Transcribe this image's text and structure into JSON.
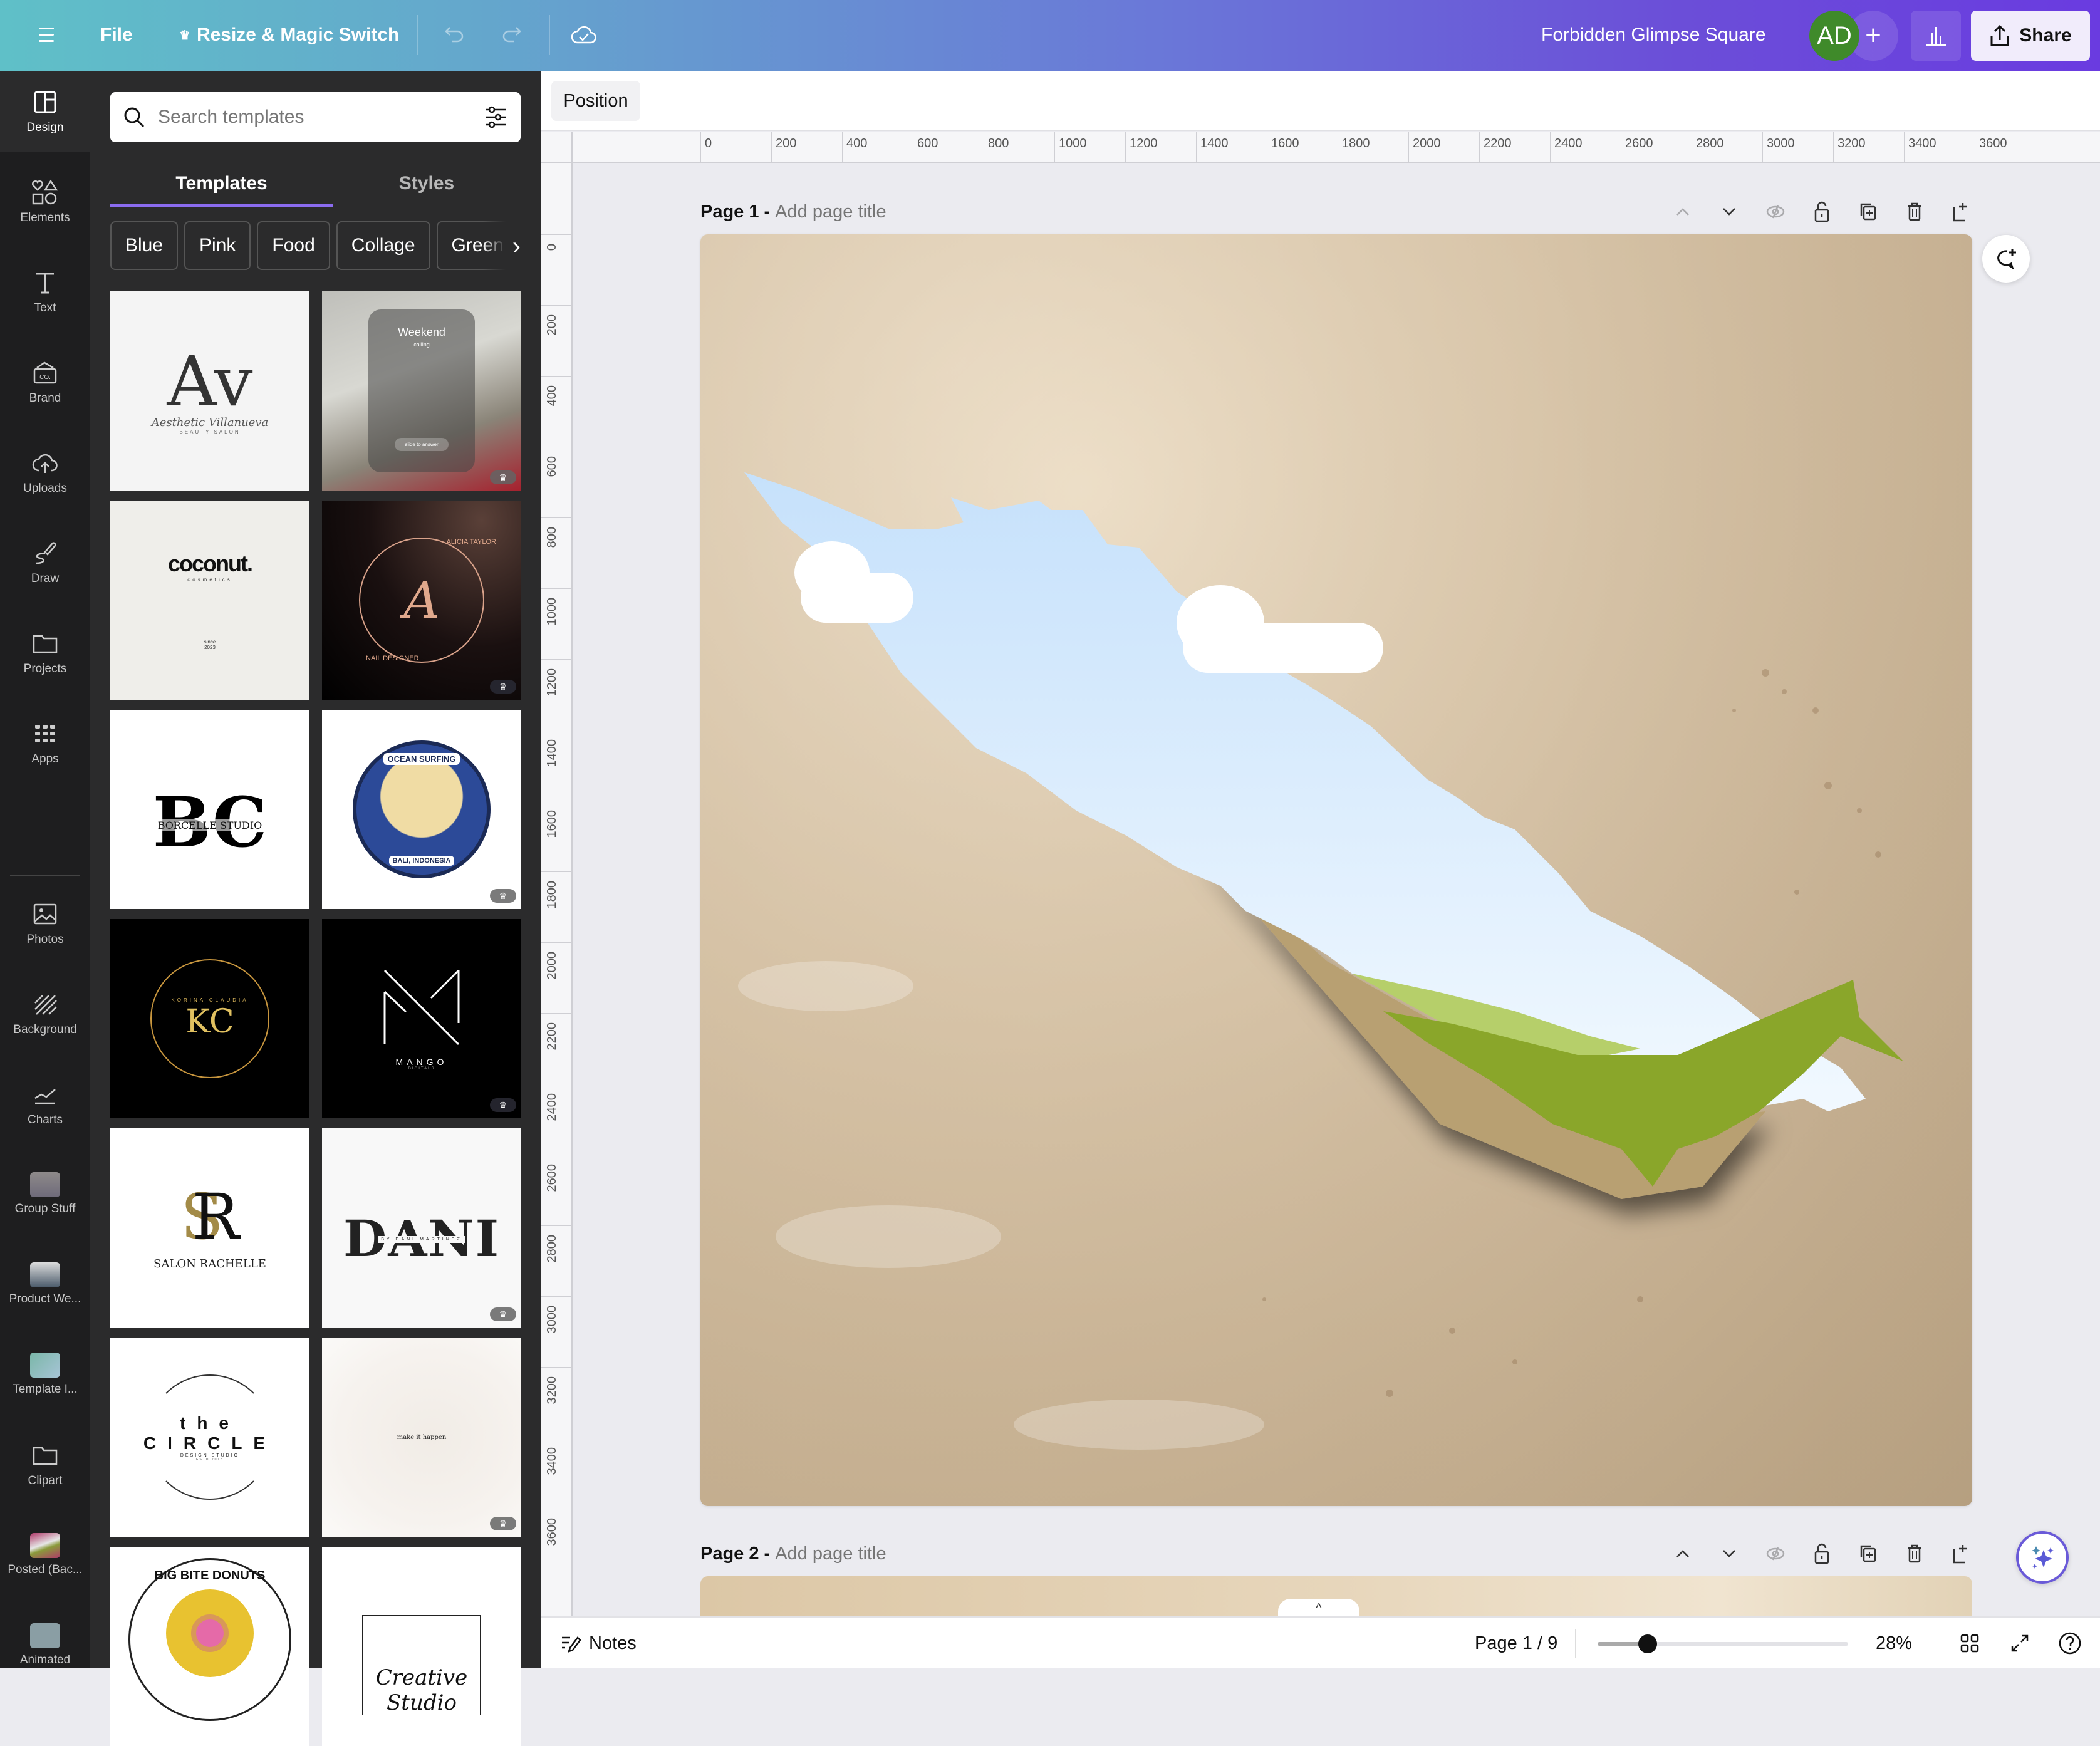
{
  "topbar": {
    "menu_icon": "hamburger-menu-icon",
    "file_label": "File",
    "resize_label": "Resize & Magic Switch",
    "undo_icon": "undo-icon",
    "redo_icon": "redo-icon",
    "save_status_icon": "cloud-check-icon",
    "design_title": "Forbidden Glimpse Square",
    "avatar_initials": "AD",
    "add_collaborator": "+",
    "analytics_icon": "bar-chart-icon",
    "share_label": "Share"
  },
  "rail": {
    "items": [
      {
        "label": "Design",
        "icon": "design-layout-icon",
        "active": true
      },
      {
        "label": "Elements",
        "icon": "shapes-icon"
      },
      {
        "label": "Text",
        "icon": "text-t-icon"
      },
      {
        "label": "Brand",
        "icon": "brand-kit-icon"
      },
      {
        "label": "Uploads",
        "icon": "cloud-upload-icon"
      },
      {
        "label": "Draw",
        "icon": "pen-draw-icon"
      },
      {
        "label": "Projects",
        "icon": "folder-icon"
      },
      {
        "label": "Apps",
        "icon": "apps-grid-icon"
      },
      {
        "label": "Photos",
        "icon": "image-icon"
      },
      {
        "label": "Background",
        "icon": "stripes-icon"
      },
      {
        "label": "Charts",
        "icon": "line-chart-icon"
      },
      {
        "label": "Group Stuff",
        "icon": "app-thumbnail"
      },
      {
        "label": "Product We...",
        "icon": "app-thumbnail"
      },
      {
        "label": "Template I...",
        "icon": "app-thumbnail"
      },
      {
        "label": "Clipart",
        "icon": "folder-icon"
      },
      {
        "label": "Posted (Bac...",
        "icon": "app-thumbnail"
      },
      {
        "label": "Animated",
        "icon": "app-thumbnail"
      }
    ]
  },
  "panel": {
    "search_placeholder": "Search templates",
    "tabs": [
      {
        "label": "Templates",
        "active": true
      },
      {
        "label": "Styles",
        "active": false
      }
    ],
    "chips": [
      "Blue",
      "Pink",
      "Food",
      "Collage",
      "Green"
    ],
    "templates": [
      {
        "title": "Av",
        "subtitle": "Aesthetic Villanueva",
        "tagline": "BEAUTY SALON",
        "pro": false
      },
      {
        "title": "Weekend",
        "subtitle": "calling",
        "tagline": "slide to answer",
        "pro": true
      },
      {
        "title": "coconut.",
        "subtitle": "cosmetics",
        "tagline": "since 2023",
        "pro": false
      },
      {
        "title": "A",
        "subtitle": "ALICIA TAYLOR",
        "tagline": "NAIL DESIGNER",
        "pro": true
      },
      {
        "title": "BC",
        "subtitle": "BORCELLE STUDIO",
        "tagline": "",
        "pro": false
      },
      {
        "title": "OCEAN SURFING",
        "subtitle": "BALI, INDONESIA",
        "tagline": "",
        "pro": true
      },
      {
        "title": "KC",
        "subtitle": "KORINA CLAUDIA",
        "tagline": "",
        "pro": false
      },
      {
        "title": "M",
        "subtitle": "MANGO",
        "tagline": "DIGITALS",
        "pro": true
      },
      {
        "title": "SR",
        "subtitle": "SALON RACHELLE",
        "tagline": "",
        "pro": false
      },
      {
        "title": "DANI",
        "subtitle": "BY DANI MARTINEZ",
        "tagline": "",
        "pro": true
      },
      {
        "title": "the CIRCLE",
        "subtitle": "DESIGN STUDIO",
        "tagline": "ESTD 2015",
        "pro": false
      },
      {
        "title": "make it happen",
        "subtitle": "",
        "tagline": "",
        "pro": true
      },
      {
        "title": "BIG BITE DONUTS",
        "subtitle": "",
        "tagline": "",
        "pro": false
      },
      {
        "title": "Creative",
        "subtitle": "Studio",
        "tagline": "",
        "pro": false
      }
    ],
    "pro_badge_icon": "crown-icon"
  },
  "editor": {
    "position_label": "Position",
    "ruler_h": [
      "0",
      "200",
      "400",
      "600",
      "800",
      "1000",
      "1200",
      "1400",
      "1600",
      "1800",
      "2000",
      "2200",
      "2400",
      "2600",
      "2800",
      "3000",
      "3200",
      "3400",
      "3600"
    ],
    "ruler_v": [
      "0",
      "200",
      "400",
      "600",
      "800",
      "1000",
      "1200",
      "1400",
      "1600",
      "1800",
      "2000",
      "2200",
      "2400",
      "2600",
      "2800",
      "3000",
      "3200",
      "3400",
      "3600",
      "0"
    ],
    "pages": [
      {
        "label": "Page 1 -",
        "title_placeholder": "Add page title"
      },
      {
        "label": "Page 2 -",
        "title_placeholder": "Add page title"
      }
    ],
    "page_actions": [
      "move-up-icon",
      "move-down-icon",
      "hide-icon",
      "lock-icon",
      "duplicate-icon",
      "delete-icon",
      "add-page-icon"
    ],
    "canvas_description": "Torn beige wall revealing blue sky with clouds and green hill"
  },
  "bottombar": {
    "notes_label": "Notes",
    "page_indicator": "Page 1 / 9",
    "zoom_value": 28,
    "zoom_label": "28%",
    "zoom_slider_fraction": 0.2
  },
  "colors": {
    "accent": "#8b6cf0",
    "avatar_bg": "#3f8a2a",
    "panel_bg": "#2b2b2c",
    "rail_bg": "#1e1e1f",
    "sky": "#cfe6fb",
    "grass": "#89a32a"
  }
}
